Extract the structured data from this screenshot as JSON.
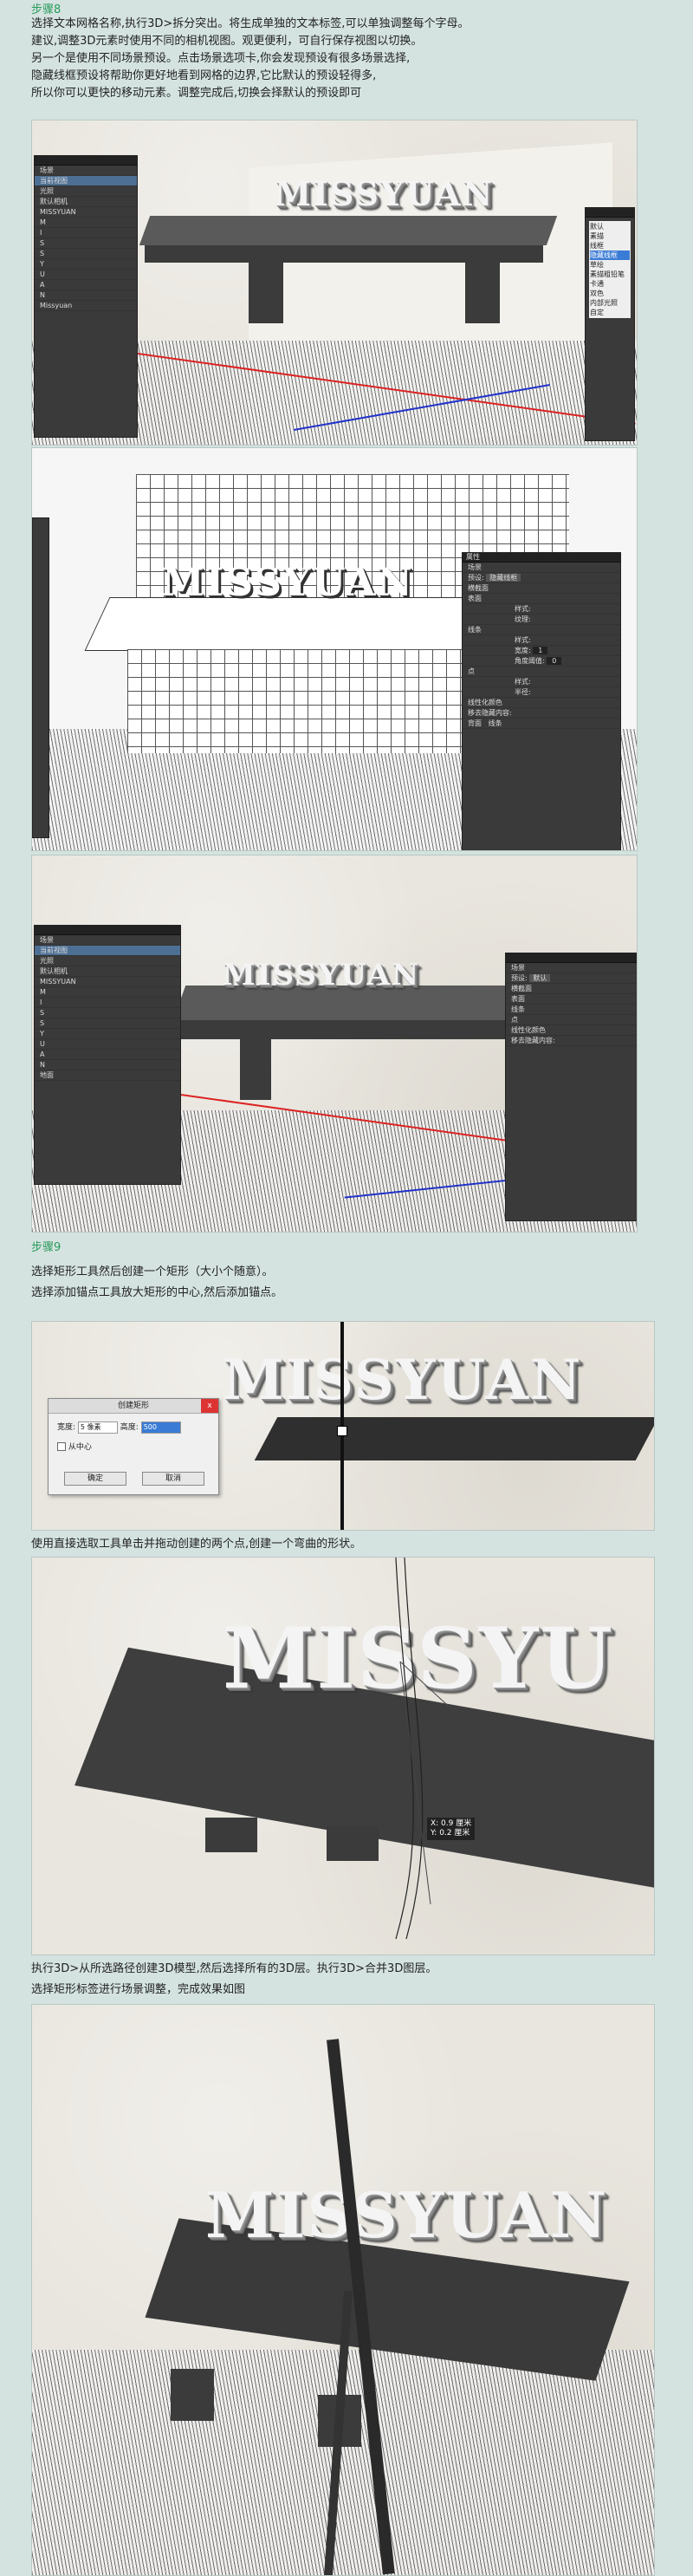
{
  "step8": {
    "heading": "步骤8",
    "lines": [
      "选择文本网格名称,执行3D>拆分突出。将生成单独的文本标签,可以单独调整每个字母。",
      "建议,调整3D元素时使用不同的相机视图。观更便利，可自行保存视图以切换。",
      "另一个是使用不同场景预设。点击场景选项卡,你会发现预设有很多场景选择,",
      "隐藏线框预设将帮助你更好地看到网格的边界,它比默认的预设轻得多,",
      "所以你可以更快的移动元素。调整完成后,切换会择默认的预设即可"
    ]
  },
  "shot1": {
    "model_text": "MISSYUAN",
    "layers": [
      "场景",
      "当前视图",
      "光照",
      "默认相机",
      "MISSYUAN",
      "M",
      "I",
      "S",
      "S",
      "Y",
      "U",
      "A",
      "N",
      "Missyuan"
    ],
    "preset_menu": [
      "默认",
      "素描",
      "线框",
      "隐藏线框",
      "草绘",
      "素描粗铅笔",
      "卡通",
      "双色",
      "内部光照",
      "自定"
    ]
  },
  "shot2": {
    "panel_title": "属性",
    "tab": "场景",
    "preset_label": "预设:",
    "preset_value": "隐藏线框",
    "fields": [
      "横截面",
      "表面",
      "样式:",
      "纹理:",
      "线条",
      "样式:",
      "宽度:",
      "角度阈值:",
      "点",
      "样式:",
      "半径:",
      "线性化颜色",
      "移去隐藏内容:",
      "背面",
      "线条"
    ],
    "width_val": "1",
    "angle_val": "0"
  },
  "shot3": {
    "model_text": "MISSYUAN",
    "preset_value": "默认",
    "layers": [
      "场景",
      "当前视图",
      "光照",
      "默认相机",
      "MISSYUAN",
      "M",
      "I",
      "S",
      "S",
      "Y",
      "U",
      "A",
      "N",
      "地面"
    ]
  },
  "step9": {
    "heading": "步骤9",
    "lines": [
      "选择矩形工具然后创建一个矩形（大小个随意）。",
      "选择添加锚点工具放大矩形的中心,然后添加锚点。"
    ]
  },
  "shot4": {
    "model_text": "MISSYUAN",
    "dialog": {
      "title": "创建矩形",
      "close": "x",
      "width_label": "宽度:",
      "width_value": "5 像素",
      "height_label": "高度:",
      "height_value": "500",
      "from_center": "从中心",
      "ok": "确定",
      "cancel": "取消"
    }
  },
  "mid_line": "使用直接选取工具单击并拖动创建的两个点,创建一个弯曲的形状。",
  "shot5": {
    "model_text": "MISSYU",
    "tooltip_lines": [
      "X: 0.9 厘米",
      "Y: 0.2 厘米"
    ]
  },
  "final_lines": [
    "执行3D>从所选路径创建3D模型,然后选择所有的3D层。执行3D>合并3D图层。",
    "选择矩形标签进行场景调整，完成效果如图"
  ],
  "shot6": {
    "model_text": "MISSYUAN"
  }
}
